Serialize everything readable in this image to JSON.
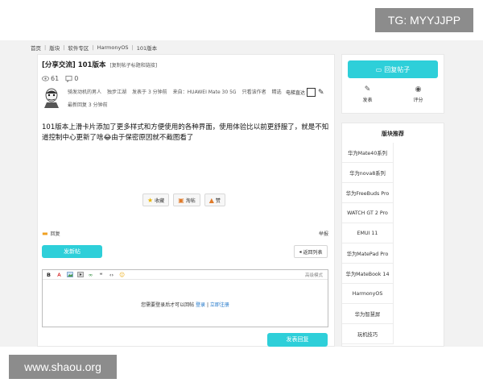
{
  "watermarks": {
    "top": "TG: MYYJJPP",
    "bottom": "www.shaou.org"
  },
  "breadcrumb": [
    "首页",
    "版块",
    "软件专区",
    "HarmonyOS",
    "101版本"
  ],
  "post": {
    "title": "[分享交流] 101版本",
    "title_sub": "[复制帖子标题和链接]",
    "views": "61",
    "comments": "0",
    "author": "骑发动机的男人",
    "author_tag": "独步江湖",
    "posted": "发表于 3 分钟前",
    "device": "来自：HUAWEI Mate 30 5G",
    "only_author": "只看该作者",
    "featured": "精选",
    "elevator": "电梯直达",
    "last_reply": "最新回复 3 分钟前",
    "content": "101版本上滑卡片添加了更多样式和方便使用的各种界面，使用体验比以前更舒服了，就是不知道控制中心更新了啥😂由于保密原因就不截图看了"
  },
  "actions": {
    "favorite": "收藏",
    "share": "淘帖",
    "like": "赞"
  },
  "reply_bar": {
    "reply": "回复",
    "report": "举报"
  },
  "buttons": {
    "new_post": "发新帖",
    "back_list": "返回列表",
    "submit_reply": "发表回复",
    "reply_post": "回复帖子"
  },
  "editor": {
    "advanced": "高级模式",
    "login_prompt": "您需要登录后才可以回帖",
    "login": "登录",
    "divider": "|",
    "register": "立即注册"
  },
  "sidebar": {
    "post_label": "发表",
    "rate_label": "评分",
    "rec_title": "版块推荐",
    "rec_items": [
      "华为Mate40系列",
      "华为nova8系列",
      "华为FreeBuds Pro",
      "WATCH GT 2 Pro",
      "EMUI 11",
      "华为MatePad Pro",
      "华为MateBook 14",
      "HarmonyOS",
      "华为智慧屏",
      "玩机技巧"
    ]
  },
  "colors": {
    "accent": "#2ecfd9",
    "link": "#1a73c8",
    "watermark_bg": "#8c8c8c",
    "page_bg": "#f2f2f2"
  }
}
